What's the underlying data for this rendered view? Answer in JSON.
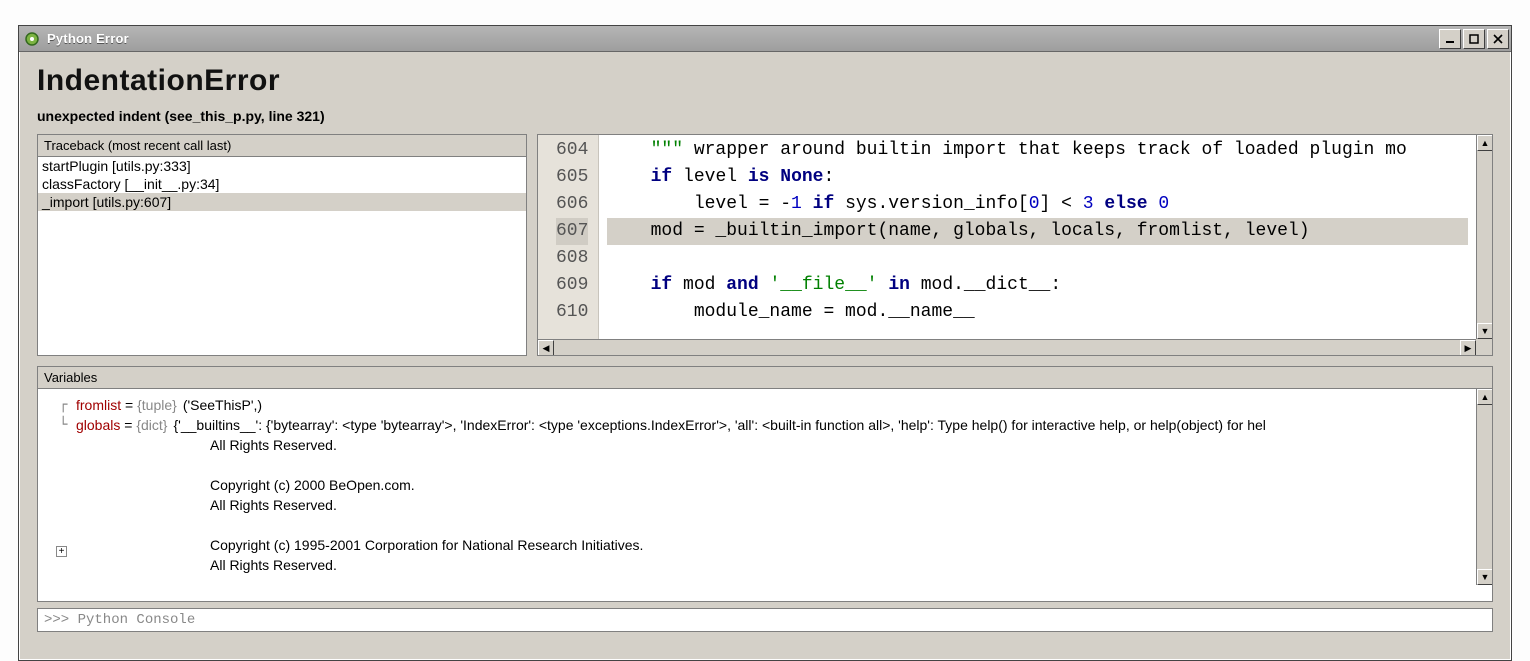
{
  "window": {
    "title": "Python Error"
  },
  "error": {
    "heading": "IndentationError",
    "subtitle": "unexpected indent (see_this_p.py, line 321)"
  },
  "traceback": {
    "header": "Traceback (most recent call last)",
    "items": [
      {
        "label": "startPlugin [utils.py:333]",
        "selected": false
      },
      {
        "label": "classFactory [__init__.py:34]",
        "selected": false
      },
      {
        "label": "_import [utils.py:607]",
        "selected": true
      }
    ]
  },
  "code": {
    "first_line_no": 604,
    "active_line_no": 607,
    "lines": [
      {
        "no": 604,
        "indent": "    ",
        "tokens": [
          {
            "t": "str",
            "v": "\"\"\""
          },
          {
            "t": "n",
            "v": " wrapper around builtin import that keeps track of loaded plugin mo"
          }
        ]
      },
      {
        "no": 605,
        "indent": "    ",
        "tokens": [
          {
            "t": "kw",
            "v": "if"
          },
          {
            "t": "n",
            "v": " level "
          },
          {
            "t": "kw",
            "v": "is"
          },
          {
            "t": "n",
            "v": " "
          },
          {
            "t": "kw",
            "v": "None"
          },
          {
            "t": "n",
            "v": ":"
          }
        ]
      },
      {
        "no": 606,
        "indent": "        ",
        "tokens": [
          {
            "t": "n",
            "v": "level = -"
          },
          {
            "t": "num",
            "v": "1"
          },
          {
            "t": "n",
            "v": " "
          },
          {
            "t": "kw",
            "v": "if"
          },
          {
            "t": "n",
            "v": " sys.version_info["
          },
          {
            "t": "num",
            "v": "0"
          },
          {
            "t": "n",
            "v": "] < "
          },
          {
            "t": "num",
            "v": "3"
          },
          {
            "t": "n",
            "v": " "
          },
          {
            "t": "kw",
            "v": "else"
          },
          {
            "t": "n",
            "v": " "
          },
          {
            "t": "num",
            "v": "0"
          }
        ]
      },
      {
        "no": 607,
        "indent": "    ",
        "tokens": [
          {
            "t": "n",
            "v": "mod = _builtin_import(name, globals, locals, fromlist, level)"
          }
        ]
      },
      {
        "no": 608,
        "indent": "",
        "tokens": []
      },
      {
        "no": 609,
        "indent": "    ",
        "tokens": [
          {
            "t": "kw",
            "v": "if"
          },
          {
            "t": "n",
            "v": " mod "
          },
          {
            "t": "kw",
            "v": "and"
          },
          {
            "t": "n",
            "v": " "
          },
          {
            "t": "str",
            "v": "'__file__'"
          },
          {
            "t": "n",
            "v": " "
          },
          {
            "t": "kw",
            "v": "in"
          },
          {
            "t": "n",
            "v": " mod.__dict__:"
          }
        ]
      },
      {
        "no": 610,
        "indent": "        ",
        "tokens": [
          {
            "t": "n",
            "v": "module_name = mod.__name__"
          }
        ]
      }
    ]
  },
  "variables": {
    "header": "Variables",
    "fromlist": {
      "name": "fromlist",
      "type": "{tuple}",
      "value": "('SeeThisP',)"
    },
    "globals": {
      "name": "globals",
      "type": "{dict}",
      "head": "{'__builtins__': {'bytearray': <type 'bytearray'>, 'IndexError': <type 'exceptions.IndexError'>, 'all': <built-in function all>, 'help': Type help() for interactive help, or help(object) for hel",
      "lines": [
        "All Rights Reserved.",
        "",
        "Copyright (c) 2000 BeOpen.com.",
        "All Rights Reserved.",
        "",
        "Copyright (c) 1995-2001 Corporation for National Research Initiatives.",
        "All Rights Reserved."
      ]
    }
  },
  "console": {
    "prompt": ">>> Python Console"
  }
}
